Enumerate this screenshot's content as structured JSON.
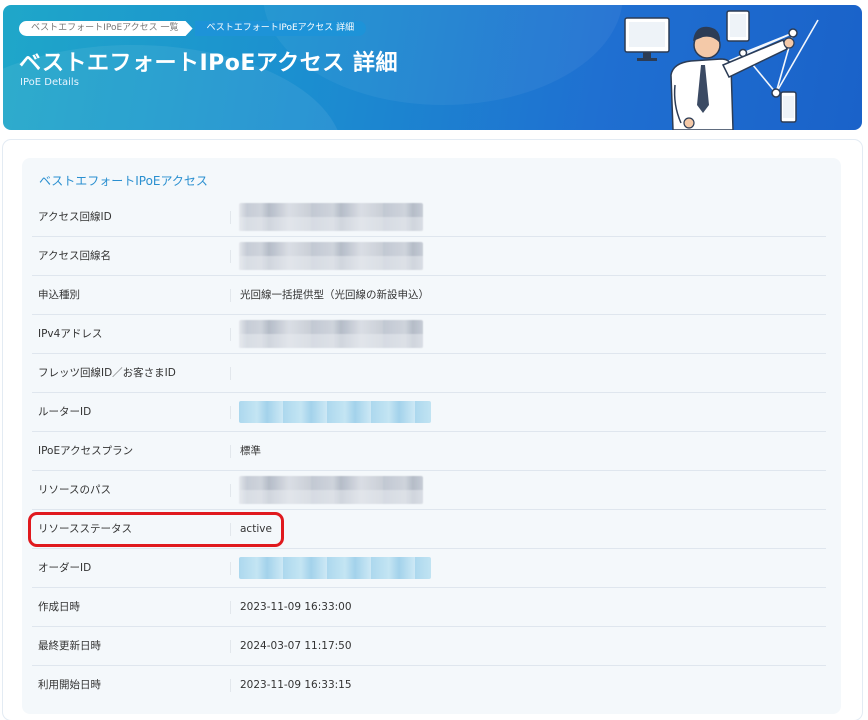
{
  "breadcrumb": {
    "list": "ベストエフォートIPoEアクセス 一覧",
    "current": "ベストエフォートIPoEアクセス 詳細"
  },
  "header": {
    "title": "ベストエフォートIPoEアクセス 詳細",
    "subtitle": "IPoE Details"
  },
  "section": {
    "title": "ベストエフォートIPoEアクセス"
  },
  "rows": [
    {
      "label": "アクセス回線ID",
      "value": "",
      "redacted": "gray"
    },
    {
      "label": "アクセス回線名",
      "value": "",
      "redacted": "gray"
    },
    {
      "label": "申込種別",
      "value": "光回線一括提供型（光回線の新設申込）"
    },
    {
      "label": "IPv4アドレス",
      "value": "",
      "redacted": "gray"
    },
    {
      "label": "フレッツ回線ID／お客さまID",
      "value": ""
    },
    {
      "label": "ルーターID",
      "value": "",
      "redacted": "blue"
    },
    {
      "label": "IPoEアクセスプラン",
      "value": "標準"
    },
    {
      "label": "リソースのパス",
      "value": "",
      "redacted": "gray"
    },
    {
      "label": "リソースステータス",
      "value": "active"
    },
    {
      "label": "オーダーID",
      "value": "",
      "redacted": "blue"
    },
    {
      "label": "作成日時",
      "value": "2023-11-09 16:33:00"
    },
    {
      "label": "最終更新日時",
      "value": "2024-03-07 11:17:50"
    },
    {
      "label": "利用開始日時",
      "value": "2023-11-09 16:33:15"
    }
  ],
  "colors": {
    "accent": "#2a8fd0",
    "highlight": "#e0191e"
  }
}
